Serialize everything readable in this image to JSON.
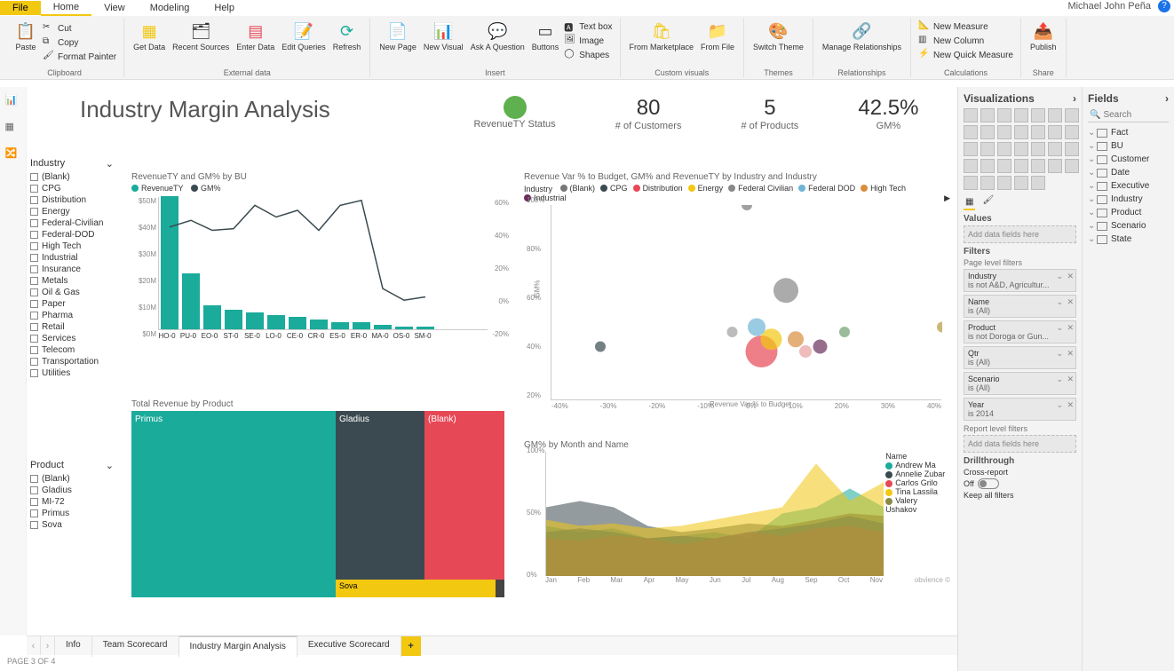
{
  "menu": {
    "file": "File",
    "home": "Home",
    "view": "View",
    "modeling": "Modeling",
    "help": "Help"
  },
  "user": "Michael John Peña",
  "ribbon": {
    "paste": "Paste",
    "cut": "Cut",
    "copy": "Copy",
    "format_painter": "Format Painter",
    "get_data": "Get Data",
    "recent": "Recent Sources",
    "enter": "Enter Data",
    "edit": "Edit Queries",
    "refresh": "Refresh",
    "new_page": "New Page",
    "new_visual": "New Visual",
    "ask": "Ask A Question",
    "buttons": "Buttons",
    "textbox": "Text box",
    "image": "Image",
    "shapes": "Shapes",
    "marketplace": "From Marketplace",
    "from_file": "From File",
    "switch_theme": "Switch Theme",
    "manage_rel": "Manage Relationships",
    "new_measure": "New Measure",
    "new_column": "New Column",
    "new_quick": "New Quick Measure",
    "publish": "Publish",
    "groups": {
      "clipboard": "Clipboard",
      "external": "External data",
      "insert": "Insert",
      "custom": "Custom visuals",
      "themes": "Themes",
      "relationships": "Relationships",
      "calculations": "Calculations",
      "share": "Share"
    }
  },
  "report": {
    "title": "Industry Margin Analysis",
    "kpis": {
      "status_label": "RevenueTY Status",
      "customers_val": "80",
      "customers_label": "# of Customers",
      "products_val": "5",
      "products_label": "# of Products",
      "gm_val": "42.5%",
      "gm_label": "GM%"
    }
  },
  "slicers": {
    "industry_title": "Industry",
    "industry_items": [
      "(Blank)",
      "CPG",
      "Distribution",
      "Energy",
      "Federal-Civilian",
      "Federal-DOD",
      "High Tech",
      "Industrial",
      "Insurance",
      "Metals",
      "Oil & Gas",
      "Paper",
      "Pharma",
      "Retail",
      "Services",
      "Telecom",
      "Transportation",
      "Utilities"
    ],
    "product_title": "Product",
    "product_items": [
      "(Blank)",
      "Gladius",
      "MI-72",
      "Primus",
      "Sova"
    ]
  },
  "charts": {
    "bar_title": "RevenueTY and GM% by BU",
    "bar_legend": [
      "RevenueTY",
      "GM%"
    ],
    "scatter_title": "Revenue Var % to Budget, GM% and RevenueTY by Industry and Industry",
    "scatter_legend_label": "Industry",
    "scatter_legend": [
      "(Blank)",
      "CPG",
      "Distribution",
      "Energy",
      "Federal Civilian",
      "Federal DOD",
      "High Tech",
      "Industrial"
    ],
    "treemap_title": "Total Revenue by Product",
    "treemap_items": [
      "Primus",
      "Gladius",
      "(Blank)",
      "Sova"
    ],
    "area_title": "GM% by Month and Name",
    "area_legend_label": "Name",
    "area_legend": [
      "Andrew Ma",
      "Annelie Zubar",
      "Carlos Grilo",
      "Tina Lassila",
      "Valery Ushakov"
    ],
    "watermark": "obvience ©"
  },
  "chart_data": {
    "bar": {
      "type": "bar_line_combo",
      "categories": [
        "HO-0",
        "PU-0",
        "EO-0",
        "ST-0",
        "SE-0",
        "LO-0",
        "CE-0",
        "CR-0",
        "ES-0",
        "ER-0",
        "MA-0",
        "OS-0",
        "SM-0"
      ],
      "bar_values": [
        55,
        23,
        10,
        8,
        7,
        6,
        5,
        4,
        3,
        3,
        2,
        1,
        1
      ],
      "bar_unit": "M",
      "line_values_pct": [
        42,
        46,
        40,
        41,
        55,
        48,
        52,
        40,
        55,
        58,
        5,
        -2,
        0
      ],
      "y_left_ticks": [
        "$0M",
        "$10M",
        "$20M",
        "$30M",
        "$40M",
        "$50M"
      ],
      "y_right_ticks": [
        "-20%",
        "0%",
        "20%",
        "40%",
        "60%"
      ]
    },
    "scatter": {
      "type": "scatter",
      "xlabel": "Revenue Var % to Budget",
      "ylabel": "GM%",
      "x_ticks": [
        "-40%",
        "-30%",
        "-20%",
        "-10%",
        "0%",
        "10%",
        "20%",
        "30%",
        "40%"
      ],
      "y_ticks": [
        "20%",
        "40%",
        "60%",
        "80%",
        "100%"
      ],
      "points": [
        {
          "industry": "(Blank)",
          "x": 0,
          "y": 100,
          "size": 6
        },
        {
          "industry": "CPG",
          "x": -30,
          "y": 42,
          "size": 6
        },
        {
          "industry": "Distribution",
          "x": 3,
          "y": 40,
          "size": 18
        },
        {
          "industry": "Energy",
          "x": 5,
          "y": 45,
          "size": 12
        },
        {
          "industry": "Federal Civilian",
          "x": 8,
          "y": 65,
          "size": 14
        },
        {
          "industry": "Federal DOD",
          "x": 2,
          "y": 50,
          "size": 10
        },
        {
          "industry": "High Tech",
          "x": 10,
          "y": 45,
          "size": 9
        },
        {
          "industry": "Industrial",
          "x": 15,
          "y": 42,
          "size": 8
        },
        {
          "industry": "Insurance",
          "x": 40,
          "y": 50,
          "size": 6
        },
        {
          "industry": "Metals",
          "x": -3,
          "y": 48,
          "size": 6
        },
        {
          "industry": "Retail",
          "x": 12,
          "y": 40,
          "size": 7
        },
        {
          "industry": "Services",
          "x": 20,
          "y": 48,
          "size": 6
        }
      ]
    },
    "treemap": {
      "type": "treemap",
      "items": [
        {
          "name": "Primus",
          "weight": 55,
          "color": "#1aab9b"
        },
        {
          "name": "Gladius",
          "weight": 25,
          "color": "#3b4a50"
        },
        {
          "name": "(Blank)",
          "weight": 18,
          "color": "#e74856"
        },
        {
          "name": "Sova",
          "weight": 2,
          "color": "#f2c811"
        }
      ]
    },
    "area": {
      "type": "area",
      "categories": [
        "Jan",
        "Feb",
        "Mar",
        "Apr",
        "May",
        "Jun",
        "Jul",
        "Aug",
        "Sep",
        "Oct",
        "Nov"
      ],
      "y_ticks": [
        "0%",
        "50%",
        "100%"
      ],
      "series": [
        {
          "name": "Andrew Ma",
          "color": "#1aab9b",
          "values": [
            40,
            35,
            38,
            30,
            32,
            35,
            30,
            50,
            55,
            70,
            55
          ]
        },
        {
          "name": "Annelie Zubar",
          "color": "#3b4a50",
          "values": [
            55,
            60,
            55,
            40,
            35,
            38,
            42,
            40,
            45,
            50,
            48
          ]
        },
        {
          "name": "Carlos Grilo",
          "color": "#e74856",
          "values": [
            30,
            28,
            32,
            30,
            25,
            30,
            35,
            32,
            38,
            40,
            35
          ]
        },
        {
          "name": "Tina Lassila",
          "color": "#f2c811",
          "values": [
            45,
            40,
            42,
            38,
            40,
            45,
            50,
            55,
            90,
            60,
            75
          ]
        },
        {
          "name": "Valery Ushakov",
          "color": "#8a8a45",
          "values": [
            35,
            38,
            35,
            30,
            32,
            30,
            35,
            38,
            42,
            48,
            42
          ]
        }
      ]
    }
  },
  "pagetabs": {
    "tabs": [
      "Info",
      "Team Scorecard",
      "Industry Margin Analysis",
      "Executive Scorecard"
    ],
    "active": 2,
    "status": "PAGE 3 OF 4"
  },
  "viz_pane": {
    "title": "Visualizations",
    "values_label": "Values",
    "values_well": "Add data fields here",
    "filters_label": "Filters",
    "page_filters_label": "Page level filters",
    "filters": [
      {
        "name": "Industry",
        "desc": "is not A&D, Agricultur..."
      },
      {
        "name": "Name",
        "desc": "is (All)"
      },
      {
        "name": "Product",
        "desc": "is not Doroga or Gun..."
      },
      {
        "name": "Qtr",
        "desc": "is (All)"
      },
      {
        "name": "Scenario",
        "desc": "is (All)"
      },
      {
        "name": "Year",
        "desc": "is 2014"
      }
    ],
    "report_filters_label": "Report level filters",
    "report_well": "Add data fields here",
    "drill_label": "Drillthrough",
    "cross_label": "Cross-report",
    "off_label": "Off",
    "keep_label": "Keep all filters"
  },
  "fields_pane": {
    "title": "Fields",
    "search": "Search",
    "tables": [
      "Fact",
      "BU",
      "Customer",
      "Date",
      "Executive",
      "Industry",
      "Product",
      "Scenario",
      "State"
    ]
  }
}
